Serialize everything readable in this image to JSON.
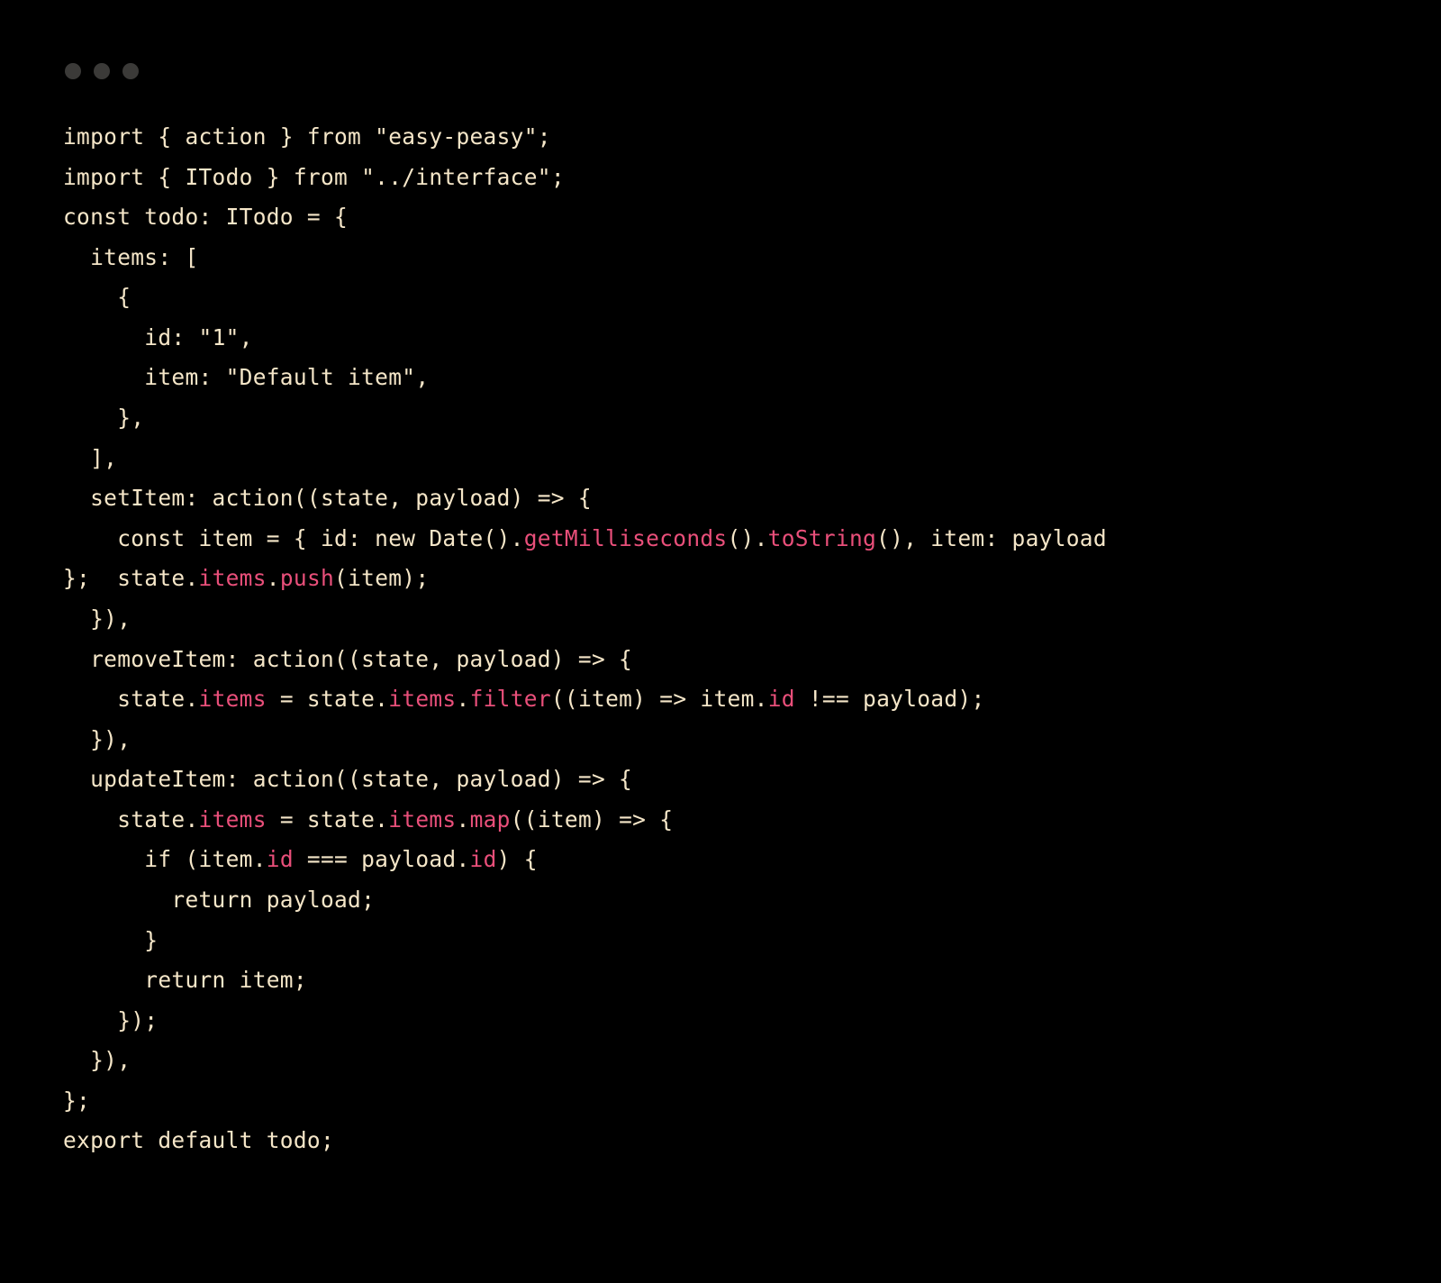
{
  "window": {
    "traffic_lights": [
      "close",
      "minimize",
      "zoom"
    ]
  },
  "code": {
    "lines": [
      [
        {
          "t": "import { action } from ",
          "c": "kw"
        },
        {
          "t": "\"easy-peasy\"",
          "c": "str"
        },
        {
          "t": ";",
          "c": "kw"
        }
      ],
      [
        {
          "t": "import { ITodo } from ",
          "c": "kw"
        },
        {
          "t": "\"../interface\"",
          "c": "str"
        },
        {
          "t": ";",
          "c": "kw"
        }
      ],
      [
        {
          "t": "const todo: ITodo = {",
          "c": "kw"
        }
      ],
      [
        {
          "t": "  items: [",
          "c": "kw"
        }
      ],
      [
        {
          "t": "    {",
          "c": "kw"
        }
      ],
      [
        {
          "t": "      id: ",
          "c": "kw"
        },
        {
          "t": "\"1\"",
          "c": "str"
        },
        {
          "t": ",",
          "c": "kw"
        }
      ],
      [
        {
          "t": "      item: ",
          "c": "kw"
        },
        {
          "t": "\"Default item\"",
          "c": "str"
        },
        {
          "t": ",",
          "c": "kw"
        }
      ],
      [
        {
          "t": "    },",
          "c": "kw"
        }
      ],
      [
        {
          "t": "  ],",
          "c": "kw"
        }
      ],
      [
        {
          "t": "  setItem: action((state, payload) => {",
          "c": "kw"
        }
      ],
      [
        {
          "t": "    const item = { id: new Date().",
          "c": "kw"
        },
        {
          "t": "getMilliseconds",
          "c": "method"
        },
        {
          "t": "().",
          "c": "kw"
        },
        {
          "t": "toString",
          "c": "method"
        },
        {
          "t": "(), item: payload ",
          "c": "kw"
        }
      ],
      [
        {
          "t": "};  state.",
          "c": "kw"
        },
        {
          "t": "items",
          "c": "prop"
        },
        {
          "t": ".",
          "c": "kw"
        },
        {
          "t": "push",
          "c": "method"
        },
        {
          "t": "(item);",
          "c": "kw"
        }
      ],
      [
        {
          "t": "  }),",
          "c": "kw"
        }
      ],
      [
        {
          "t": "  removeItem: action((state, payload) => {",
          "c": "kw"
        }
      ],
      [
        {
          "t": "    state.",
          "c": "kw"
        },
        {
          "t": "items",
          "c": "prop"
        },
        {
          "t": " = state.",
          "c": "kw"
        },
        {
          "t": "items",
          "c": "prop"
        },
        {
          "t": ".",
          "c": "kw"
        },
        {
          "t": "filter",
          "c": "method"
        },
        {
          "t": "((item) => item.",
          "c": "kw"
        },
        {
          "t": "id",
          "c": "prop"
        },
        {
          "t": " !== payload);",
          "c": "kw"
        }
      ],
      [
        {
          "t": "  }),",
          "c": "kw"
        }
      ],
      [
        {
          "t": "  updateItem: action((state, payload) => {",
          "c": "kw"
        }
      ],
      [
        {
          "t": "    state.",
          "c": "kw"
        },
        {
          "t": "items",
          "c": "prop"
        },
        {
          "t": " = state.",
          "c": "kw"
        },
        {
          "t": "items",
          "c": "prop"
        },
        {
          "t": ".",
          "c": "kw"
        },
        {
          "t": "map",
          "c": "method"
        },
        {
          "t": "((item) => {",
          "c": "kw"
        }
      ],
      [
        {
          "t": "      if (item.",
          "c": "kw"
        },
        {
          "t": "id",
          "c": "prop"
        },
        {
          "t": " === payload.",
          "c": "kw"
        },
        {
          "t": "id",
          "c": "prop"
        },
        {
          "t": ") {",
          "c": "kw"
        }
      ],
      [
        {
          "t": "        return payload;",
          "c": "kw"
        }
      ],
      [
        {
          "t": "      }",
          "c": "kw"
        }
      ],
      [
        {
          "t": "      return item;",
          "c": "kw"
        }
      ],
      [
        {
          "t": "    });",
          "c": "kw"
        }
      ],
      [
        {
          "t": "  }),",
          "c": "kw"
        }
      ],
      [
        {
          "t": "};",
          "c": "kw"
        }
      ],
      [
        {
          "t": "export default todo;",
          "c": "kw"
        }
      ]
    ]
  }
}
